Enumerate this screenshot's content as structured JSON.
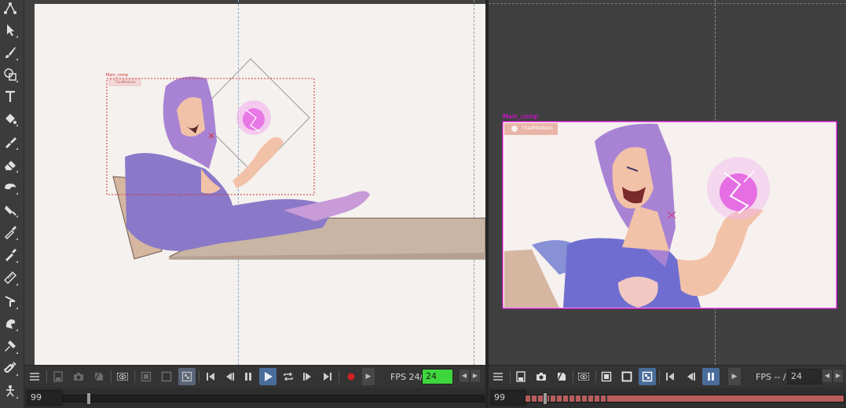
{
  "toolbar": {
    "tools": [
      {
        "name": "animate-tool-icon"
      },
      {
        "name": "select-tool-icon"
      },
      {
        "name": "brush-tool-icon"
      },
      {
        "name": "shape-tool-icon"
      },
      {
        "name": "text-tool-icon"
      },
      {
        "name": "paint-bucket-icon"
      },
      {
        "name": "paint-unpainted-icon"
      },
      {
        "name": "eraser-tool-icon"
      },
      {
        "name": "ink-tool-icon"
      },
      {
        "name": "paint-brush-fill-icon"
      },
      {
        "name": "eyedropper-icon"
      },
      {
        "name": "tint-eyedropper-icon"
      },
      {
        "name": "ruler-icon"
      },
      {
        "name": "cutter-icon"
      },
      {
        "name": "smudge-tool-icon"
      },
      {
        "name": "hammer-icon"
      },
      {
        "name": "magnet-icon"
      },
      {
        "name": "rig-tool-icon"
      }
    ]
  },
  "left_view": {
    "comp_label": "Main_comp",
    "layer_label": "TSadMadison",
    "playback": {
      "fps_label": "FPS 24/",
      "fps_value": "24",
      "frame": "99",
      "progress": 0.06
    }
  },
  "right_view": {
    "comp_label": "Main_comp",
    "layer_label": "TSadMadison",
    "playback": {
      "fps_label": "FPS -- /",
      "fps_value": "24",
      "frame": "99",
      "progress": 0.05
    }
  },
  "colors": {
    "fps_active_bg": "#3dd63d",
    "comp_frame": "#ff00ff",
    "camera_frame": "#d23030",
    "play_active": "#4a6c9a",
    "timeline_bar": "#b85c5c"
  }
}
